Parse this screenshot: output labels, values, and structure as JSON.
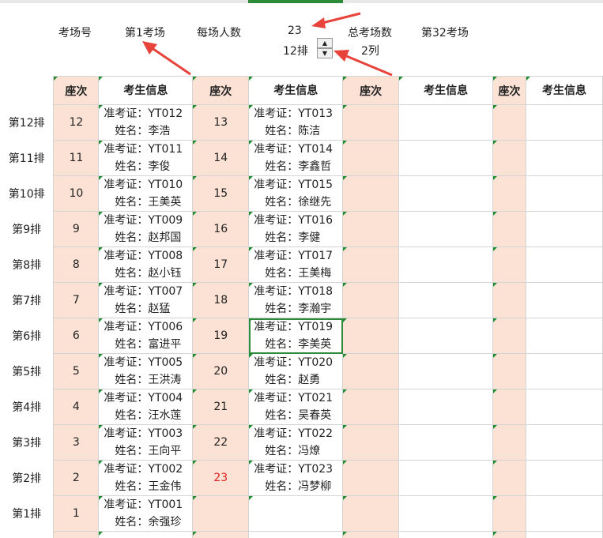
{
  "header": {
    "exam_room_label": "考场号",
    "exam_room_value": "第1考场",
    "per_room_label": "每场人数",
    "per_room_value": "23",
    "total_rooms_label": "总考场数",
    "total_rooms_value": "第32考场",
    "rows_value": "12排",
    "cols_value": "2列"
  },
  "columns": {
    "seat": "座次",
    "info": "考生信息"
  },
  "row_labels": [
    "第12排",
    "第11排",
    "第10排",
    "第9排",
    "第8排",
    "第7排",
    "第6排",
    "第5排",
    "第4排",
    "第3排",
    "第2排",
    "第1排"
  ],
  "left_seats": [
    "12",
    "11",
    "10",
    "9",
    "8",
    "7",
    "6",
    "5",
    "4",
    "3",
    "2",
    "1"
  ],
  "left_info": [
    {
      "id": "准考证：YT012",
      "name": "姓名：李浩"
    },
    {
      "id": "准考证：YT011",
      "name": "姓名：李俊"
    },
    {
      "id": "准考证：YT010",
      "name": "姓名：王美英"
    },
    {
      "id": "准考证：YT009",
      "name": "姓名：赵邦国"
    },
    {
      "id": "准考证：YT008",
      "name": "姓名：赵小钰"
    },
    {
      "id": "准考证：YT007",
      "name": "姓名：赵猛"
    },
    {
      "id": "准考证：YT006",
      "name": "姓名：富进平"
    },
    {
      "id": "准考证：YT005",
      "name": "姓名：王洪涛"
    },
    {
      "id": "准考证：YT004",
      "name": "姓名：汪水莲"
    },
    {
      "id": "准考证：YT003",
      "name": "姓名：王向平"
    },
    {
      "id": "准考证：YT002",
      "name": "姓名：王金伟"
    },
    {
      "id": "准考证：YT001",
      "name": "姓名：余强珍"
    }
  ],
  "right_seats": [
    "13",
    "14",
    "15",
    "16",
    "17",
    "18",
    "19",
    "20",
    "21",
    "22",
    "23",
    ""
  ],
  "right_info": [
    {
      "id": "准考证：YT013",
      "name": "姓名：陈洁"
    },
    {
      "id": "准考证：YT014",
      "name": "姓名：李鑫哲"
    },
    {
      "id": "准考证：YT015",
      "name": "姓名：徐继先"
    },
    {
      "id": "准考证：YT016",
      "name": "姓名：李健"
    },
    {
      "id": "准考证：YT017",
      "name": "姓名：王美梅"
    },
    {
      "id": "准考证：YT018",
      "name": "姓名：李瀚宇"
    },
    {
      "id": "准考证：YT019",
      "name": "姓名：李美英"
    },
    {
      "id": "准考证：YT020",
      "name": "姓名：赵勇"
    },
    {
      "id": "准考证：YT021",
      "name": "姓名：吴春英"
    },
    {
      "id": "准考证：YT022",
      "name": "姓名：冯燎"
    },
    {
      "id": "准考证：YT023",
      "name": "姓名：冯梦柳"
    },
    {
      "id": "",
      "name": ""
    }
  ],
  "colors": {
    "seat_fill": "#fbe2d5",
    "annotation_arrow": "#e8433a",
    "selection": "#2e8b3a",
    "last_seat": "#e02020"
  },
  "icons": {
    "spin_up": "triangle-up-icon",
    "spin_down": "triangle-down-icon"
  }
}
